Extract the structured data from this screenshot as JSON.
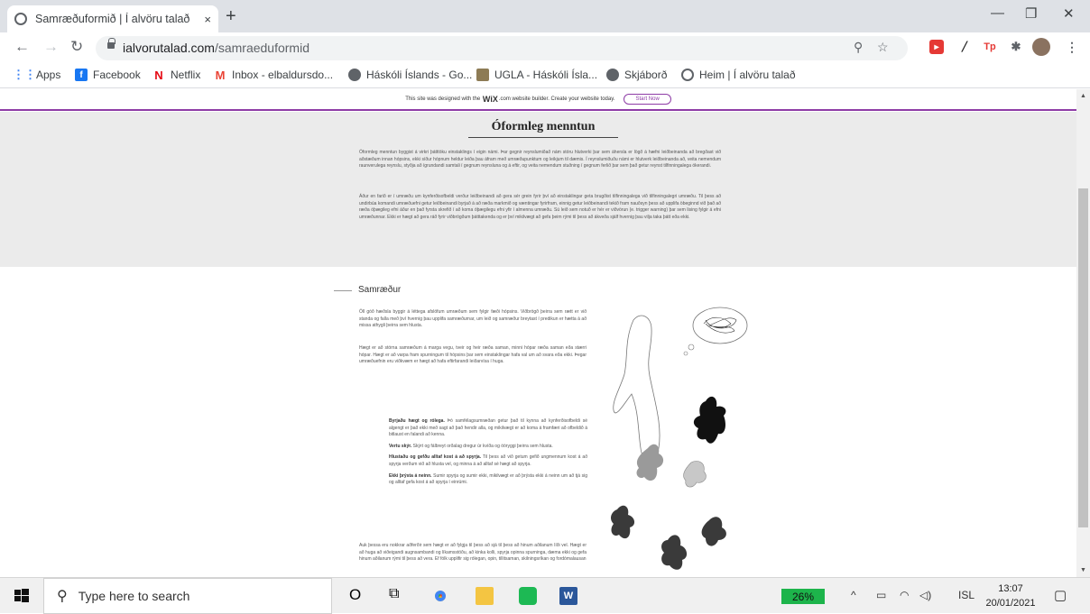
{
  "browser": {
    "tab_title": "Samræðuformið | Í alvöru talað",
    "tab_close": "×",
    "new_tab": "+",
    "url_domain": "ialvorutalad.com",
    "url_path": "/samraeduformid",
    "bookmarks": [
      {
        "label": "Apps",
        "icon": "apps-grid-icon",
        "color": "#4285f4"
      },
      {
        "label": "Facebook",
        "icon": "facebook-icon",
        "color": "#1877f2"
      },
      {
        "label": "Netflix",
        "icon": "netflix-icon",
        "color": "#e50914"
      },
      {
        "label": "Inbox - elbaldursdo...",
        "icon": "gmail-icon",
        "color": "#ea4335"
      },
      {
        "label": "Háskóli Íslands - Go...",
        "icon": "globe-icon",
        "color": "#5f6368"
      },
      {
        "label": "UGLA - Háskóli Ísla...",
        "icon": "ugla-icon",
        "color": "#8d7b55"
      },
      {
        "label": "Skjáborð",
        "icon": "globe-icon",
        "color": "#5f6368"
      },
      {
        "label": "Heim | Í alvöru talað",
        "icon": "globe-icon",
        "color": "#5f6368"
      }
    ]
  },
  "page": {
    "wix_text": "This site was designed with the",
    "wix_brand": "WiX",
    "wix_text2": ".com website builder. Create your website today.",
    "wix_button": "Start Now",
    "section1_title": "Óformleg menntun",
    "section1_p1": "Óformleg menntun byggist á virkri þátttöku einstaklings í eigin námi. Þar gegnir reynslumiðað nám stóru hlutverki þar sem áhersla er lögð á hæfni leiðbeinanda að bregðast við aðstæðum innan hópsins, ekki síður hópnum heldur leiða þau áfram með umræðupunktum og leikjum til dæmis. Í reynslumiðuðu námi er hlutverk leiðbeinanda að, veita nemendum raunverulega reynslu, styðja að ígrundandi samtali í gegnum reynsluna og á eftir, og veita nemendum stuðning í gegnum ferlið þar sem það getur reynst tilfinningalega ókerandi.",
    "section1_p2": "Áður en farið er í umræðu um kynferðisofbeldi verður leiðbeinandi að gera sér grein fyrir því að einstaklingar geta brugðist tilfinningalega við tilfinningalegri umræðu. Til þess að undirbúa komandi umræðuefni getur leiðbeinandi byrjað á að ræða markmið og væntingar fyrirfram, einnig getur leiðbeinandi tekið fram nauðsyn þess að upplifa öbeginnd við það að ræða óþægileg efni áður en það fyrsta skrefið í að koma óþægilegu efni yfir í almenna umræðu. Sú leið sem notuð er hér er viðvörun (e. trigger warning) þar sem lising fylgir á efni umræðunnar. Ekki er hægt að gera ráð fyrir viðbrögðum þátttakenda og er því mikilvægt að gefa þeim rými til þess að ákveða sjálf hvernig þau vilja taka þátt eða ekki.",
    "section2_title": "Samræður",
    "section2_p1": "Öll góð hæðsla byggir á léttega afslöfum umræðum sem fylgir fæði hópsins. Viðbrögð þeirra sem rætt er við standa og falla með því hvernig þau upplifa samræðurnar, um leið og samræður breytast í predikun er hætta á að missa athygli þeirra sem hlusta.",
    "section2_p2": "Hægt er að stórna samræðum á marga vegu, tveir og heir ræða saman, minni hópar ræða saman eða stærri hópar. Hægt er að varpa fram spurningum til hópsins þar sem einstaklingar hafa val um að svara eða ekki. Þegar umræðuefnin eru viðkvæm er hægt að hafa eftirfarandi leiðarvísa í huga.",
    "tips": [
      {
        "bold": "Byrjaðu hægt og rólega.",
        "text": " Þó samfélagsumræðan getur það til kynna að kynferðisofbeldi sé algengt er það ekki með sagt að það hendir alla, og mikilvægt er að koma á framfæri að ofbeldið á bitlaust en falandi að kenna."
      },
      {
        "bold": "Vertu skýr.",
        "text": " Skýrt og fálbreyt orðalag dregur úr kvíða og óöryggi þeirra sem hlusta."
      },
      {
        "bold": "Hlustaðu og gefðu alltaf kost á að spyrja.",
        "text": " Til þess að við getum gefið ungmennum kost á að spyrja verðum við að hlusta vel, og minna á að alltaf sé hægt að spyrja."
      },
      {
        "bold": "Ekki þrýsta á neinn.",
        "text": " Sumir spyrja og sumir ekki, mikilvægt er að þrýsta ekki á neinn um að tjá sig og alltaf gefa kost á að spyrja í einrúmi."
      }
    ],
    "section2_p3": "Auk þessa eru nokkrar aðferðir sem hægt er að fylgja til þess að sjá til þess að hinum aðilanum líði vel. Hægt er að huga að viðeigandi augnsambandi og líkamsstöðu, að kinka kolli, spyrja opinna spurninga, dæma ekki og gefa hinum aðilanum rými til þess að vera. Ef fólk upplifir sig rólegan, opin, tillitsaman, skilningsríkan og fordómalausan"
  },
  "taskbar": {
    "search_placeholder": "Type here to search",
    "battery": "26%",
    "lang": "ISL",
    "time": "13:07",
    "date": "20/01/2021"
  }
}
